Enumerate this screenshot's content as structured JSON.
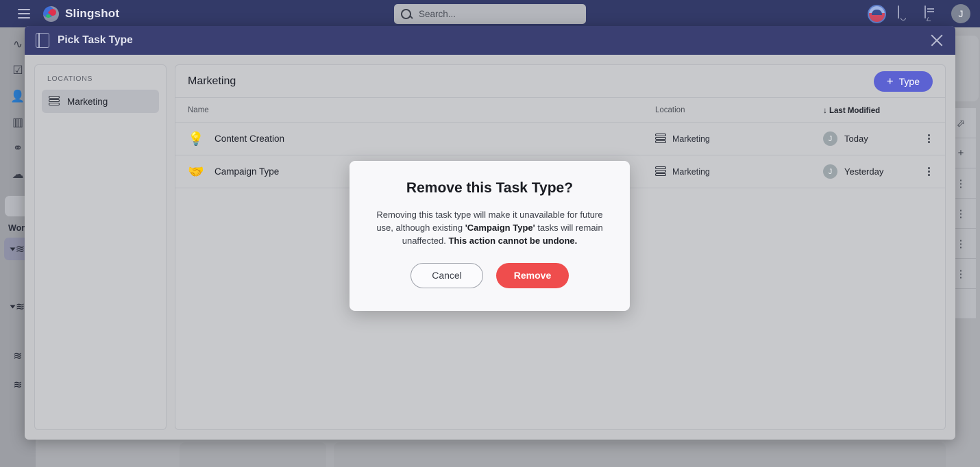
{
  "topbar": {
    "menu_icon": "hamburger-icon",
    "brand": "Slingshot",
    "search_placeholder": "Search...",
    "search_value": "",
    "user_initial": "J"
  },
  "background": {
    "rail_icons": [
      "activity-icon",
      "task-check-icon",
      "person-icon",
      "chart-icon",
      "link-icon",
      "cloud-icon"
    ],
    "rail_label": "Wor",
    "right_icons": [
      "share-icon",
      "plus-icon",
      "more-icon",
      "more-icon",
      "more-icon",
      "more-icon"
    ]
  },
  "modal": {
    "title": "Pick Task Type",
    "header_icon": "book-icon",
    "close_icon": "close-icon",
    "locations_header": "LOCATIONS",
    "locations": [
      {
        "label": "Marketing",
        "icon": "layers-icon",
        "selected": true
      }
    ],
    "list_title": "Marketing",
    "add_button": {
      "label": "Type",
      "plus": "+",
      "color": "#5c62d2"
    },
    "columns": {
      "name": "Name",
      "location": "Location",
      "last_modified": "Last Modified",
      "sort_arrow": "↓"
    },
    "rows": [
      {
        "emoji": "💡",
        "icon_name": "lightbulb-icon",
        "name": "Content Creation",
        "location": "Marketing",
        "modified_by": "J",
        "modified": "Today"
      },
      {
        "emoji": "🤝",
        "icon_name": "handshake-icon",
        "name": "Campaign Type",
        "location": "Marketing",
        "modified_by": "J",
        "modified": "Yesterday"
      }
    ]
  },
  "confirm_dialog": {
    "title": "Remove this Task Type?",
    "body_part1": "Removing this task type will make it unavailable for future use, although existing ",
    "body_highlight": "'Campaign Type'",
    "body_part2": " tasks will remain unaffected. ",
    "body_warning": "This action cannot be undone.",
    "cancel_label": "Cancel",
    "remove_label": "Remove",
    "remove_color": "#ef4d4d"
  }
}
